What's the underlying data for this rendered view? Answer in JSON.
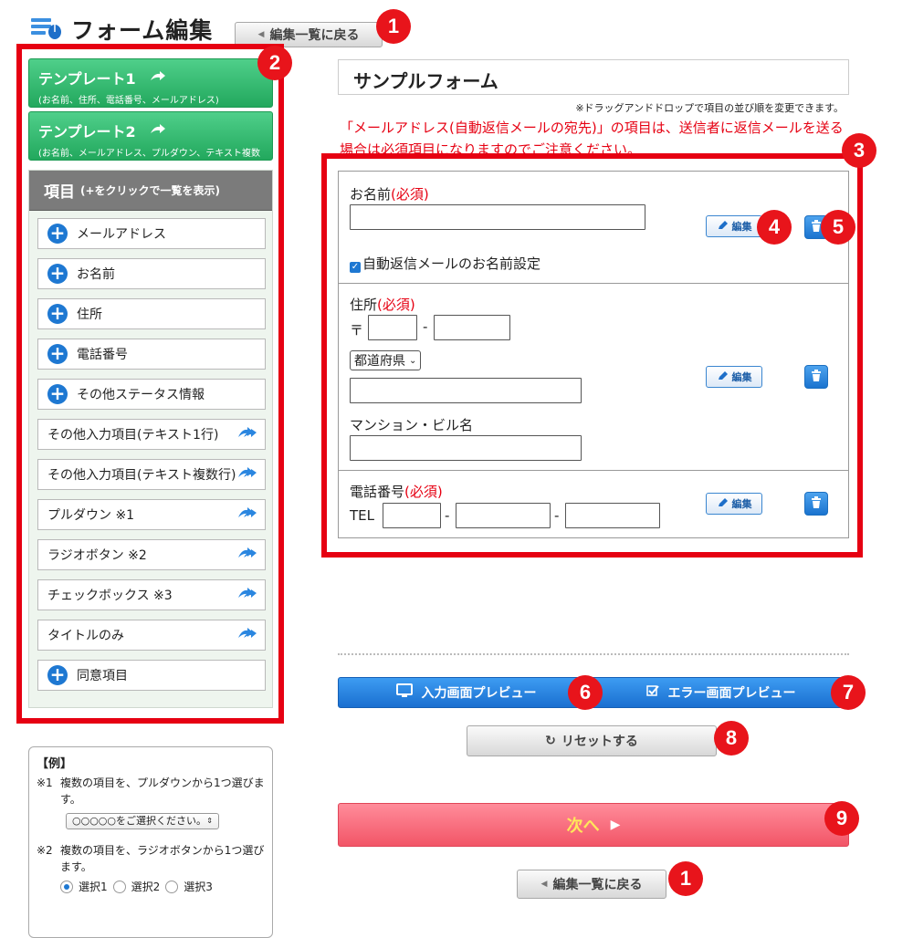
{
  "header": {
    "title": "フォーム編集",
    "back_label": "編集一覧に戻る"
  },
  "badges": [
    "1",
    "2",
    "3",
    "4",
    "5",
    "6",
    "7",
    "8",
    "9"
  ],
  "templates": [
    {
      "name": "テンプレート1",
      "desc": "(お名前、住所、電話番号、メールアドレス)"
    },
    {
      "name": "テンプレート2",
      "desc": "(お名前、メールアドレス、プルダウン、テキスト複数行)"
    }
  ],
  "items_panel": {
    "heading": "項目",
    "heading_sub": "(+をクリックで一覧を表示)",
    "items": [
      {
        "label": "メールアドレス",
        "kind": "plus"
      },
      {
        "label": "お名前",
        "kind": "plus"
      },
      {
        "label": "住所",
        "kind": "plus"
      },
      {
        "label": "電話番号",
        "kind": "plus"
      },
      {
        "label": "その他ステータス情報",
        "kind": "plus"
      },
      {
        "label": "その他入力項目(テキスト1行)",
        "kind": "arrow"
      },
      {
        "label": "その他入力項目(テキスト複数行)",
        "kind": "arrow"
      },
      {
        "label": "プルダウン ※1",
        "kind": "arrow"
      },
      {
        "label": "ラジオボタン ※2",
        "kind": "arrow"
      },
      {
        "label": "チェックボックス ※3",
        "kind": "arrow"
      },
      {
        "label": "タイトルのみ",
        "kind": "arrow"
      },
      {
        "label": "同意項目",
        "kind": "plus"
      }
    ]
  },
  "example": {
    "title": "【例】",
    "note1_key": "※1",
    "note1": "複数の項目を、プルダウンから1つ選びます。",
    "select_placeholder": "○○○○○をご選択ください。",
    "note2_key": "※2",
    "note2": "複数の項目を、ラジオボタンから1つ選びます。",
    "radio_options": [
      "選択1",
      "選択2",
      "選択3"
    ]
  },
  "form": {
    "title": "サンプルフォーム",
    "dnd_note": "※ドラッグアンドドロップで項目の並び順を変更できます。",
    "warning": "「メールアドレス(自動返信メールの宛先)」の項目は、送信者に返信メールを送る場合は必須項目になりますのでご注意ください。",
    "required_mark": "(必須)",
    "edit_label": "編集",
    "name_field": {
      "label": "お名前",
      "checkbox_label": "自動返信メールのお名前設定"
    },
    "address_field": {
      "label": "住所",
      "postal_prefix": "〒",
      "dash": "-",
      "prefecture": "都道府県",
      "building_label": "マンション・ビル名"
    },
    "phone_field": {
      "label": "電話番号",
      "prefix": "TEL",
      "dash": "-"
    }
  },
  "actions": {
    "preview_input": "入力画面プレビュー",
    "preview_error": "エラー画面プレビュー",
    "reset": "リセットする",
    "next": "次へ",
    "back": "編集一覧に戻る"
  },
  "colors": {
    "accent_red": "#e60012",
    "blue": "#1e78d2",
    "green": "#22a85d"
  }
}
